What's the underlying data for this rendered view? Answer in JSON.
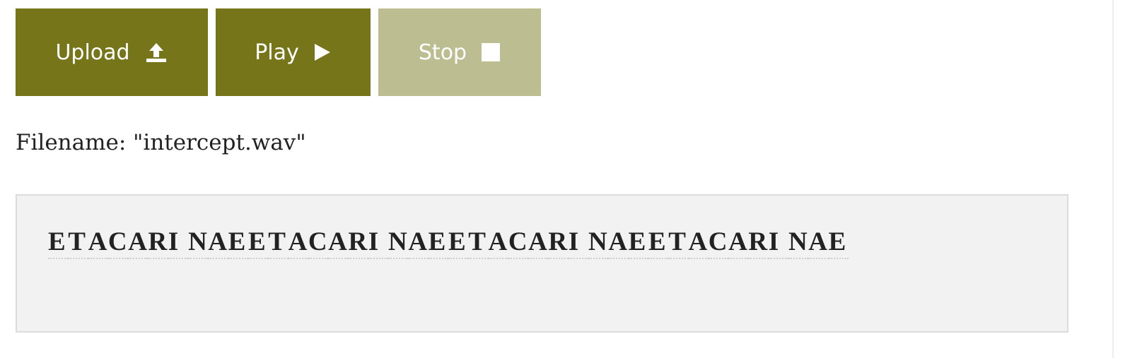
{
  "toolbar": {
    "upload": {
      "label": "Upload",
      "icon": "upload-icon"
    },
    "play": {
      "label": "Play",
      "icon": "play-icon"
    },
    "stop": {
      "label": "Stop",
      "icon": "stop-icon",
      "state": "disabled"
    }
  },
  "file": {
    "filename_text": "Filename: \"intercept.wav\""
  },
  "decoded": {
    "letters": [
      "E",
      "T",
      "A",
      "C",
      "A",
      "R",
      "I",
      "N",
      "A",
      "E",
      "E",
      "T",
      "A",
      "C",
      "A",
      "R",
      "I",
      "N",
      "A",
      "E",
      "E",
      "T",
      "A",
      "C",
      "A",
      "R",
      "I",
      "N",
      "A",
      "E",
      "E",
      "T",
      "A",
      "C",
      "A",
      "R",
      "I",
      "N",
      "A",
      "E"
    ]
  },
  "colors": {
    "button_active": "#76751a",
    "button_disabled": "#bcbd91",
    "output_background": "#f2f2f2"
  }
}
